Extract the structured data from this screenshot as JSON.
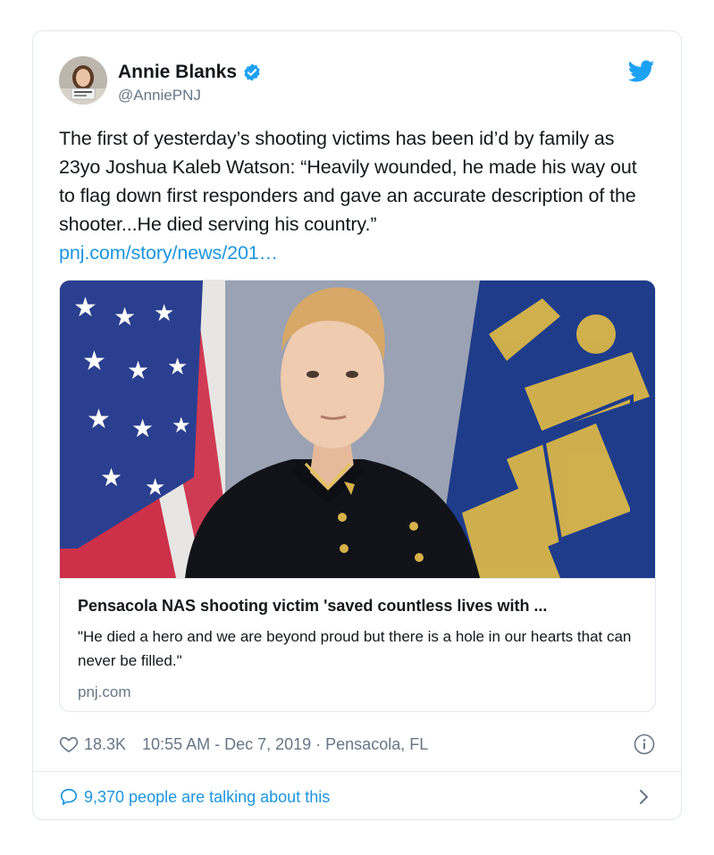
{
  "author": {
    "display_name": "Annie Blanks",
    "handle": "@AnniePNJ",
    "verified": true
  },
  "tweet": {
    "text": "The first of yesterday’s shooting victims has been id’d by family as 23yo Joshua Kaleb Watson:  “Heavily wounded, he made his way out to flag down first responders and gave an accurate description of the shooter...He died serving his country.”",
    "link_text": "pnj.com/story/news/201…"
  },
  "link_card": {
    "title": "Pensacola NAS shooting victim 'saved countless lives with ...",
    "description": "\"He died a hero and we are beyond proud but there is a hole in our hearts that can never be filled.\"",
    "domain": "pnj.com",
    "image_icon": "portrait-photo"
  },
  "meta": {
    "likes": "18.3K",
    "timestamp": "10:55 AM - Dec 7, 2019 · Pensacola, FL"
  },
  "conversation": {
    "label": "9,370 people are talking about this"
  },
  "icons": {
    "bird": "twitter-bird-icon",
    "verified": "verified-badge-icon",
    "heart": "heart-icon",
    "info": "info-icon",
    "bubble": "speech-bubble-icon",
    "chevron": "chevron-right-icon"
  },
  "colors": {
    "brand_blue": "#1da1f2",
    "link_blue": "#1b95e0",
    "muted_text": "#657786",
    "border": "#e1e8ed"
  }
}
